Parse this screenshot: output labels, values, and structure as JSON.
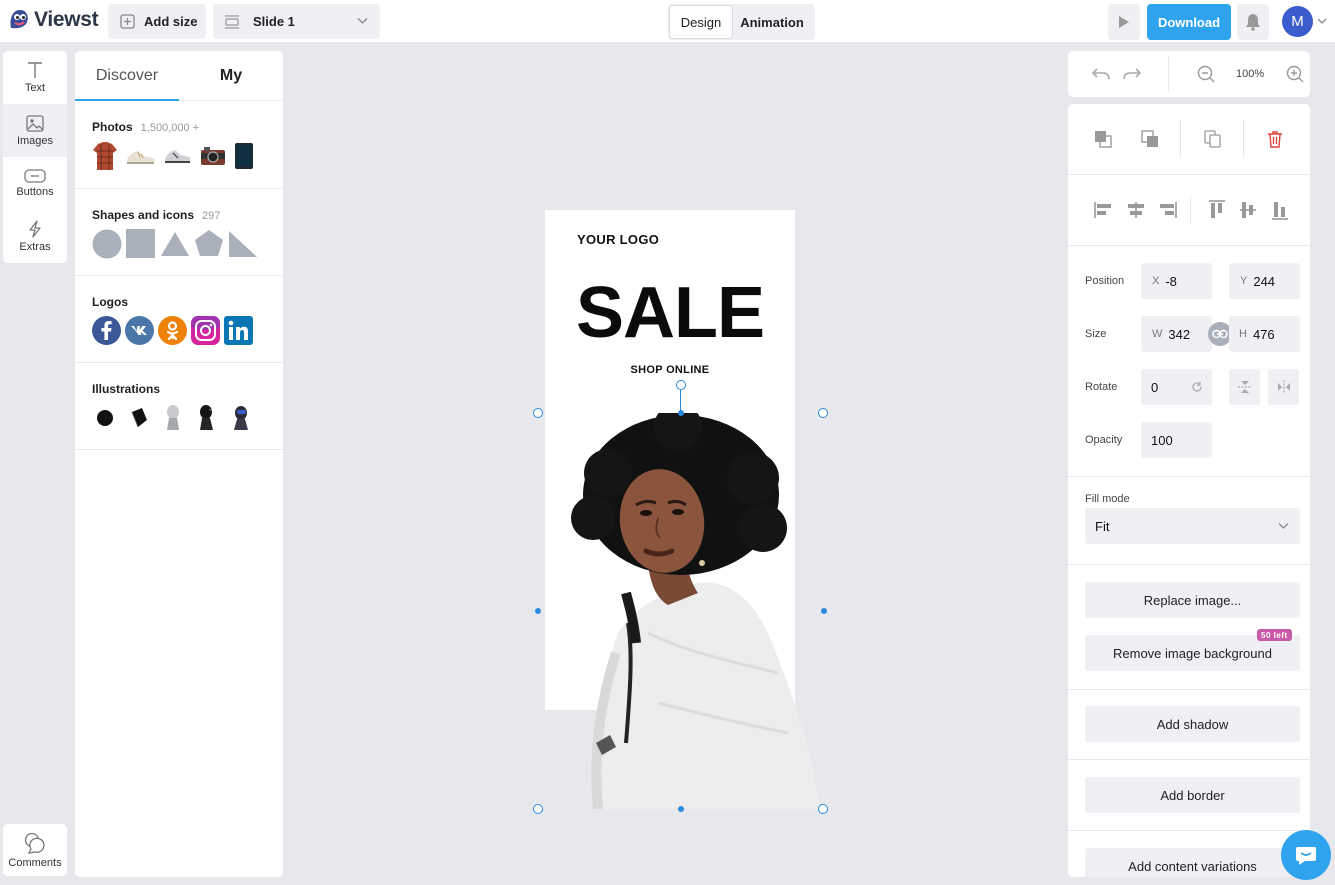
{
  "app": {
    "name": "Viewst"
  },
  "topbar": {
    "add_size": "Add size",
    "slide": "Slide 1",
    "mode_design": "Design",
    "mode_animation": "Animation",
    "download": "Download",
    "avatar_initial": "M"
  },
  "rail": {
    "items": [
      {
        "label": "Text",
        "icon": "text-icon"
      },
      {
        "label": "Images",
        "icon": "image-icon"
      },
      {
        "label": "Buttons",
        "icon": "button-icon"
      },
      {
        "label": "Extras",
        "icon": "lightning-icon"
      }
    ],
    "comments": "Comments"
  },
  "panel": {
    "tabs": [
      "Discover",
      "My"
    ],
    "photos": {
      "title": "Photos",
      "count": "1,500,000 +"
    },
    "shapes": {
      "title": "Shapes and icons",
      "count": "297"
    },
    "logos": {
      "title": "Logos"
    },
    "illustrations": {
      "title": "Illustrations"
    }
  },
  "canvas": {
    "logo_text": "YOUR LOGO",
    "headline": "SALE",
    "subline": "SHOP ONLINE"
  },
  "zoom": {
    "level": "100%"
  },
  "props": {
    "position_label": "Position",
    "x_prefix": "X",
    "x": "-8",
    "y_prefix": "Y",
    "y": "244",
    "size_label": "Size",
    "w_prefix": "W",
    "w": "342",
    "h_prefix": "H",
    "h": "476",
    "rotate_label": "Rotate",
    "rotate": "0",
    "opacity_label": "Opacity",
    "opacity": "100",
    "fill_mode_label": "Fill mode",
    "fill_mode": "Fit",
    "replace_image": "Replace image...",
    "remove_bg": "Remove image background",
    "remove_bg_badge": "50 left",
    "add_shadow": "Add shadow",
    "add_border": "Add border",
    "add_variations": "Add content variations"
  },
  "colors": {
    "accent": "#2fa3ee",
    "danger": "#e0423a",
    "badge": "#c85aa8"
  }
}
